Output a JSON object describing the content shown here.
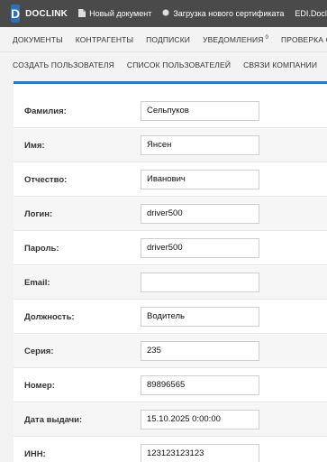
{
  "topbar": {
    "brand": "DOCLINK",
    "logo_letter": "D",
    "items": [
      {
        "label": "Новый документ",
        "icon": "document-icon"
      },
      {
        "label": "Загрузка нового сертификата",
        "icon": "circle-icon"
      },
      {
        "label": "EDI.Doclink",
        "icon": "edi-icon"
      }
    ]
  },
  "menu": {
    "row1": [
      {
        "label": "ДОКУМЕНТЫ"
      },
      {
        "label": "КОНТРАГЕНТЫ"
      },
      {
        "label": "ПОДПИСКИ"
      },
      {
        "label": "УВЕДОМЛЕНИЯ",
        "badge": "0"
      },
      {
        "label": "ПРОВЕРКА СЕРТИФИКАТА"
      }
    ],
    "row2": [
      {
        "label": "СОЗДАТЬ ПОЛЬЗОВАТЕЛЯ"
      },
      {
        "label": "СПИСОК ПОЛЬЗОВАТЕЛЕЙ"
      },
      {
        "label": "СВЯЗИ КОМПАНИИ"
      }
    ]
  },
  "form": {
    "fields": [
      {
        "label": "Фамилия:",
        "value": "Сельпуков"
      },
      {
        "label": "Имя:",
        "value": "Янсен"
      },
      {
        "label": "Отчество:",
        "value": "Иванович"
      },
      {
        "label": "Логин:",
        "value": "driver500"
      },
      {
        "label": "Пароль:",
        "value": "driver500"
      },
      {
        "label": "Email:",
        "value": ""
      },
      {
        "label": "Должность:",
        "value": "Водитель"
      },
      {
        "label": "Серия:",
        "value": "235"
      },
      {
        "label": "Номер:",
        "value": "89896565"
      },
      {
        "label": "Дата выдачи:",
        "value": "15.10.2025 0:00:00"
      },
      {
        "label": "ИНН:",
        "value": "123123123123"
      }
    ]
  },
  "colors": {
    "topbar": "#4a4a4a",
    "accent": "#2f76c6",
    "logo": "#2f6fb6"
  }
}
